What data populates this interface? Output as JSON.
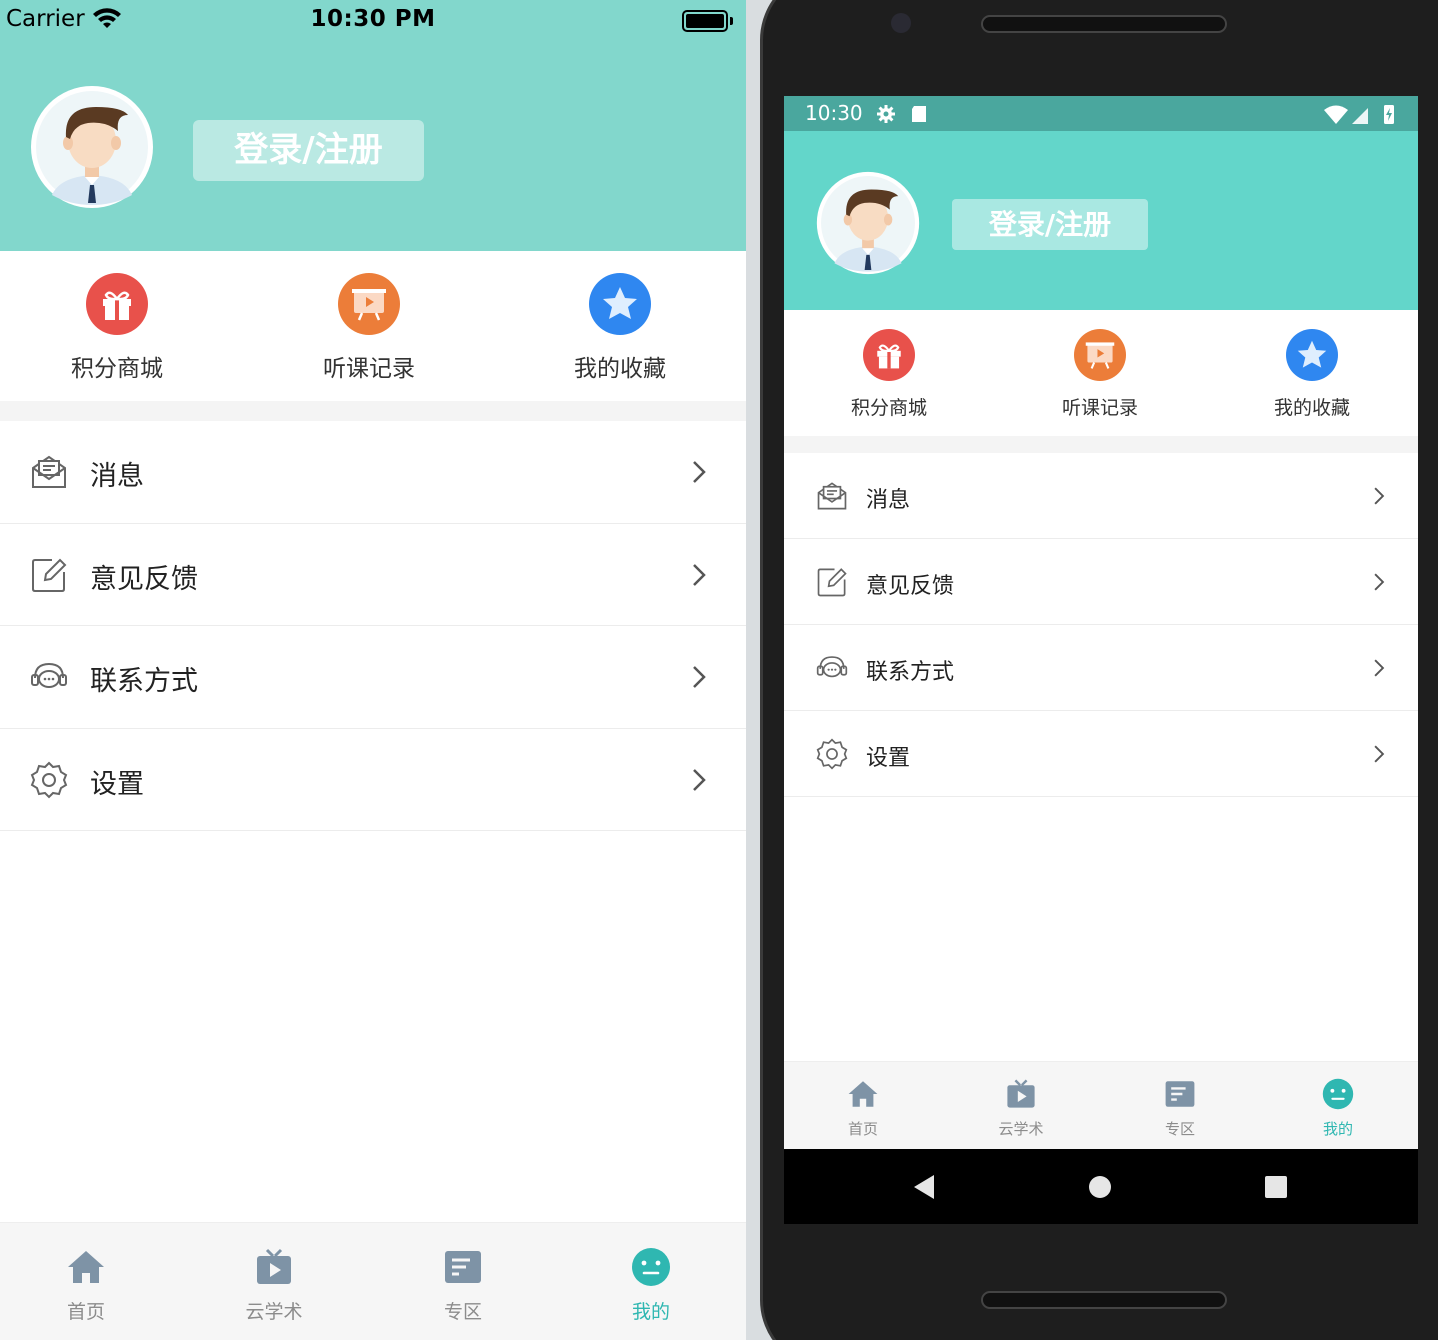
{
  "ios": {
    "status": {
      "carrier": "Carrier",
      "time": "10:30 PM"
    },
    "header": {
      "login_label": "登录/注册",
      "bg_color": "#82d7cc"
    },
    "quick_actions": [
      {
        "label": "积分商城",
        "icon": "gift-icon",
        "color": "#e8514b"
      },
      {
        "label": "听课记录",
        "icon": "presentation-icon",
        "color": "#ec7d39"
      },
      {
        "label": "我的收藏",
        "icon": "star-icon",
        "color": "#2f87f0"
      }
    ],
    "menu": [
      {
        "label": "消息",
        "icon": "message-icon"
      },
      {
        "label": "意见反馈",
        "icon": "edit-icon"
      },
      {
        "label": "联系方式",
        "icon": "headset-icon"
      },
      {
        "label": "设置",
        "icon": "gear-icon"
      }
    ],
    "tabs": [
      {
        "label": "首页",
        "icon": "home-icon"
      },
      {
        "label": "云学术",
        "icon": "tv-icon"
      },
      {
        "label": "专区",
        "icon": "list-icon"
      },
      {
        "label": "我的",
        "icon": "smiley-icon",
        "active": true
      }
    ]
  },
  "android": {
    "status": {
      "time": "10:30"
    },
    "header": {
      "login_label": "登录/注册",
      "bg_color": "#63d6ca"
    },
    "quick_actions": [
      {
        "label": "积分商城",
        "icon": "gift-icon",
        "color": "#e8514b"
      },
      {
        "label": "听课记录",
        "icon": "presentation-icon",
        "color": "#ec7d39"
      },
      {
        "label": "我的收藏",
        "icon": "star-icon",
        "color": "#2f87f0"
      }
    ],
    "menu": [
      {
        "label": "消息",
        "icon": "message-icon"
      },
      {
        "label": "意见反馈",
        "icon": "edit-icon"
      },
      {
        "label": "联系方式",
        "icon": "headset-icon"
      },
      {
        "label": "设置",
        "icon": "gear-icon"
      }
    ],
    "tabs": [
      {
        "label": "首页",
        "icon": "home-icon"
      },
      {
        "label": "云学术",
        "icon": "tv-icon"
      },
      {
        "label": "专区",
        "icon": "list-icon"
      },
      {
        "label": "我的",
        "icon": "smiley-icon",
        "active": true
      }
    ],
    "nav_buttons": [
      "back-icon",
      "home-circle-icon",
      "recents-icon"
    ]
  },
  "colors": {
    "accent": "#2fb7b1",
    "tab_inactive": "#7e93a6"
  }
}
